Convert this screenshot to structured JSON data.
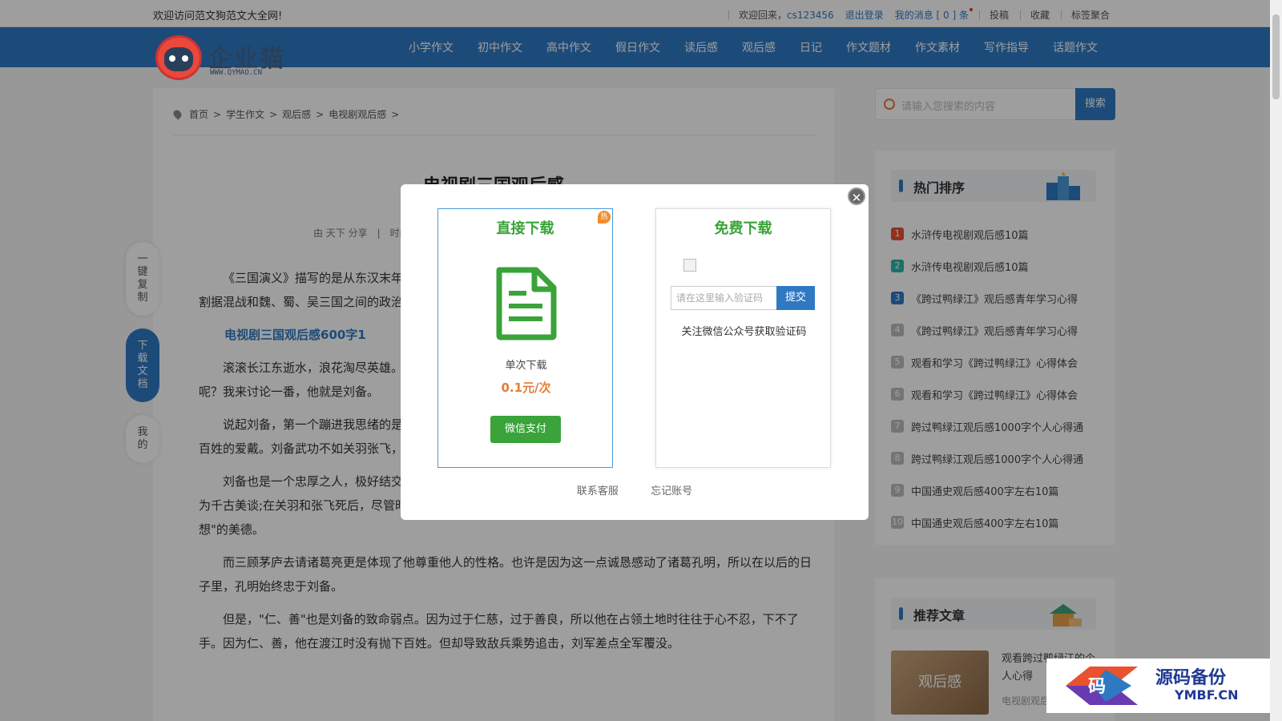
{
  "topbar": {
    "welcome": "欢迎访问范文狗范文大全网!",
    "greeting": "欢迎回来，",
    "username": "cs123456",
    "logout": "退出登录",
    "messages": "我的消息 [ 0 ] 条",
    "submit": "投稿",
    "favorites": "收藏",
    "tags": "标签聚合"
  },
  "logo": {
    "brand": "企业猫",
    "url": "WWW.QYMAO.CN"
  },
  "nav": [
    "小学作文",
    "初中作文",
    "高中作文",
    "假日作文",
    "读后感",
    "观后感",
    "日记",
    "作文题材",
    "作文素材",
    "写作指导",
    "话题作文"
  ],
  "breadcrumb": [
    "首页",
    ">",
    "学生作文",
    ">",
    "观后感",
    ">",
    "电视剧观后感",
    ">"
  ],
  "article": {
    "title": "电视剧三国观后感",
    "meta": "由 天下 分享　|　时间",
    "p1": "《三国演义》描写的是从东汉末年到西晋初年之间近百年的历史风云，以描写战争为主，诉说了东汉末年的群雄割据混战和魏、蜀、吴三国之间的政治和军事斗争，为了大家学习方便，小编特意准备了以下内容。",
    "h1": "电视剧三国观后感600字1",
    "p2": "滚滚长江东逝水，浪花淘尽英雄。是非成败转头空，青山依旧在，几度夕阳红。在三国中，我最欣赏的英雄是谁呢？我来讨论一番，他就是刘备。",
    "p3": "说起刘备，第一个蹦进我思绪的是他仁厚爱民的形象。他在当阳长坂坡被曹操追击时，始终走不抛弃百姓，深得百姓的爱戴。刘备武功不如关羽张飞，政治能力也没有曹操强。可他为何还得民心，我想大概是因为他的心志吧。",
    "p4": "刘备也是一个忠厚之人，极好结交英雄豪杰。书中第一回讲述玄德\"刘关张桃园三结义，生死之交\".这次结义被誉为千古美谈;在关羽和张飞死后，尽管时机不合适，刘备还是念着要为两名兄弟报仇，足以见刘备\"忠厚，为他人着想\"的美德。",
    "p5": "而三顾茅庐去请诸葛亮更是体现了他尊重他人的性格。也许是因为这一点诚恳感动了诸葛孔明，所以在以后的日子里，孔明始终忠于刘备。",
    "p6": "但是，\"仁、善\"也是刘备的致命弱点。因为过于仁慈，过于善良，所以他在占领土地时往往于心不忍，下不了手。因为仁、善，他在渡江时没有抛下百姓。但却导致敌兵乘势追击，刘军差点全军覆没。"
  },
  "float": {
    "copy": "一键复制",
    "download": "下载文档",
    "mine": "我的"
  },
  "search": {
    "placeholder": "请输入您搜索的内容",
    "button": "搜索"
  },
  "hot": {
    "title": "热门排序",
    "items": [
      {
        "num": "1",
        "text": "水浒传电视剧观后感10篇",
        "color": "#e8522f"
      },
      {
        "num": "2",
        "text": "水浒传电视剧观后感10篇",
        "color": "#2bb7a8"
      },
      {
        "num": "3",
        "text": "《跨过鸭绿江》观后感青年学习心得",
        "color": "#2f79c3"
      },
      {
        "num": "4",
        "text": "《跨过鸭绿江》观后感青年学习心得",
        "color": "#bbbbbb"
      },
      {
        "num": "5",
        "text": "观看和学习《跨过鸭绿江》心得体会",
        "color": "#bbbbbb"
      },
      {
        "num": "6",
        "text": "观看和学习《跨过鸭绿江》心得体会",
        "color": "#bbbbbb"
      },
      {
        "num": "7",
        "text": "跨过鸭绿江观后感1000字个人心得通",
        "color": "#bbbbbb"
      },
      {
        "num": "8",
        "text": "跨过鸭绿江观后感1000字个人心得通",
        "color": "#bbbbbb"
      },
      {
        "num": "9",
        "text": "中国通史观后感400字左右10篇",
        "color": "#bbbbbb"
      },
      {
        "num": "10",
        "text": "中国通史观后感400字左右10篇",
        "color": "#bbbbbb"
      }
    ]
  },
  "recommend": {
    "title": "推荐文章",
    "img_label": "观后感",
    "text": "观看跨过鸭绿江的个人心得",
    "sub": "电视剧观后"
  },
  "modal": {
    "direct_title": "直接下载",
    "hot_badge": "热",
    "single": "单次下载",
    "price": "0.1元/次",
    "pay": "微信支付",
    "free_title": "免费下载",
    "code_placeholder": "请在这里输入验证码",
    "code_submit": "提交",
    "tip": "关注微信公众号获取验证码",
    "contact": "联系客服",
    "forgot": "忘记账号"
  },
  "watermark": {
    "cn": "源码备份",
    "en": "YMBF.CN",
    "mark": "码"
  }
}
